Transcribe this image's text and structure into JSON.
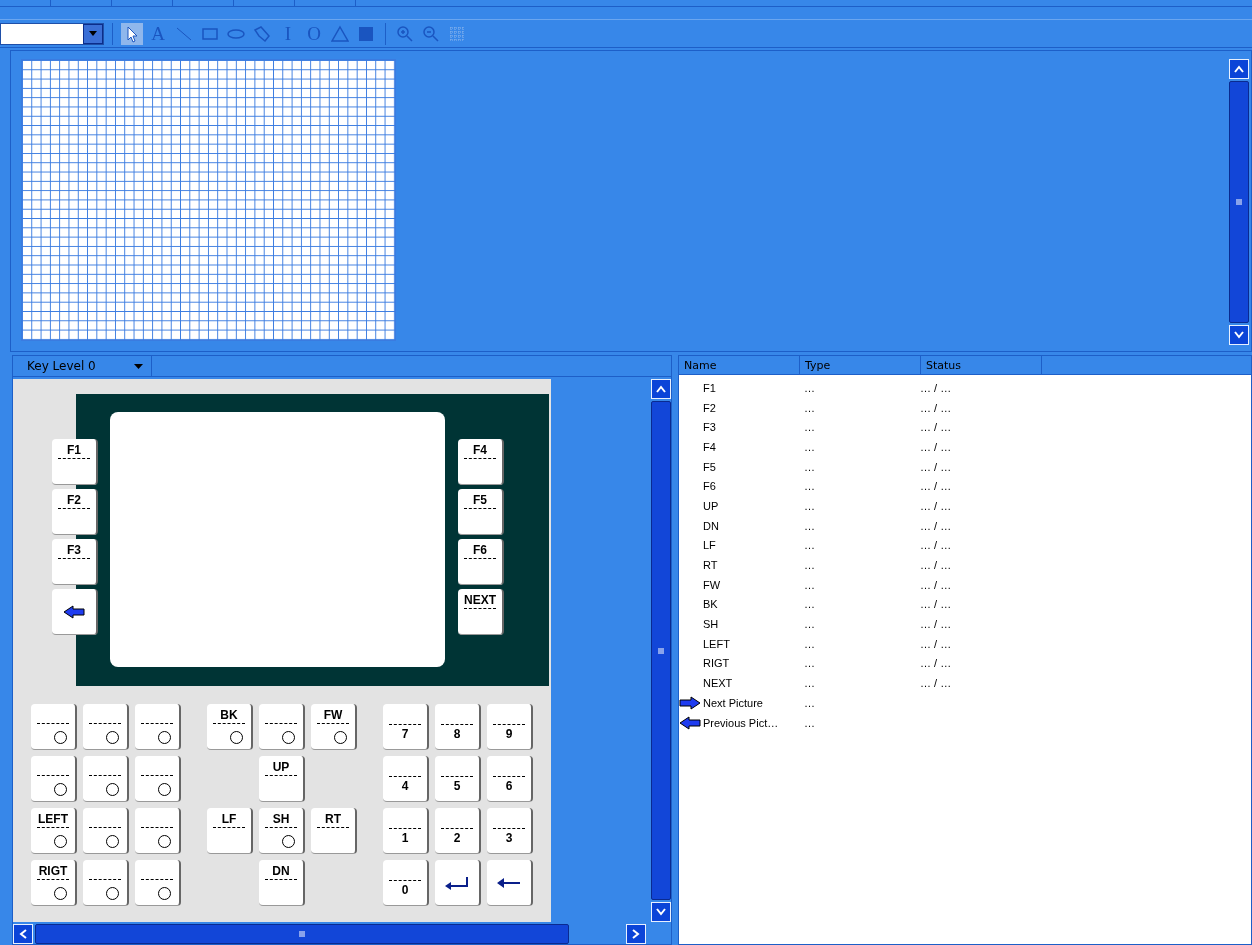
{
  "toolbar": {
    "tools": [
      {
        "kind": "pointer",
        "selected": true
      },
      {
        "kind": "glyph",
        "glyph": "A",
        "selected": false
      },
      {
        "kind": "line",
        "selected": false
      },
      {
        "kind": "rect",
        "selected": false
      },
      {
        "kind": "ellipse",
        "selected": false
      },
      {
        "kind": "polygon",
        "selected": false
      },
      {
        "kind": "glyph",
        "glyph": "I",
        "selected": false
      },
      {
        "kind": "glyph",
        "glyph": "O",
        "selected": false
      },
      {
        "kind": "warning",
        "selected": false
      },
      {
        "kind": "fill",
        "selected": false
      },
      {
        "kind": "zoom-in",
        "selected": false
      },
      {
        "kind": "zoom-out",
        "selected": false
      },
      {
        "kind": "grid",
        "selected": false
      }
    ]
  },
  "key_level": {
    "label": "Key Level 0"
  },
  "device": {
    "left_keys": [
      {
        "kind": "label",
        "label": "F1",
        "led": false
      },
      {
        "kind": "label",
        "label": "F2",
        "led": false
      },
      {
        "kind": "label",
        "label": "F3",
        "led": false
      },
      {
        "kind": "back-arrow"
      }
    ],
    "right_keys": [
      {
        "kind": "label",
        "label": "F4",
        "led": false
      },
      {
        "kind": "label",
        "label": "F5",
        "led": false
      },
      {
        "kind": "label",
        "label": "F6",
        "led": false
      },
      {
        "kind": "label",
        "label": "NEXT",
        "led": false
      }
    ]
  },
  "keypad": {
    "blocks": [
      [
        [
          {
            "kind": "label",
            "led": true
          },
          {
            "kind": "label",
            "led": true
          },
          {
            "kind": "label",
            "led": true
          }
        ],
        [
          {
            "kind": "label",
            "led": true
          },
          {
            "kind": "label",
            "led": true
          },
          {
            "kind": "label",
            "led": true
          }
        ],
        [
          {
            "kind": "label",
            "label": "LEFT",
            "led": true
          },
          {
            "kind": "label",
            "led": true
          },
          {
            "kind": "label",
            "led": true
          }
        ],
        [
          {
            "kind": "label",
            "label": "RIGT",
            "led": true
          },
          {
            "kind": "label",
            "led": true
          },
          {
            "kind": "label",
            "led": true
          }
        ]
      ],
      {
        "top": [
          {
            "kind": "label",
            "label": "BK",
            "led": true
          },
          {
            "kind": "label",
            "led": true
          },
          {
            "kind": "label",
            "label": "FW",
            "led": true
          }
        ],
        "up": {
          "kind": "label",
          "label": "UP",
          "led": false
        },
        "middle": [
          {
            "kind": "label",
            "label": "LF",
            "led": false
          },
          {
            "kind": "label",
            "label": "SH",
            "led": true
          },
          {
            "kind": "label",
            "label": "RT",
            "led": false
          }
        ],
        "down": {
          "kind": "label",
          "label": "DN",
          "led": false
        }
      },
      [
        [
          {
            "kind": "digit",
            "label": "7"
          },
          {
            "kind": "digit",
            "label": "8"
          },
          {
            "kind": "digit",
            "label": "9"
          }
        ],
        [
          {
            "kind": "digit",
            "label": "4"
          },
          {
            "kind": "digit",
            "label": "5"
          },
          {
            "kind": "digit",
            "label": "6"
          }
        ],
        [
          {
            "kind": "digit",
            "label": "1"
          },
          {
            "kind": "digit",
            "label": "2"
          },
          {
            "kind": "digit",
            "label": "3"
          }
        ],
        [
          {
            "kind": "digit",
            "label": "0"
          },
          {
            "kind": "enter"
          },
          {
            "kind": "backspace"
          }
        ]
      ]
    ]
  },
  "list": {
    "columns": [
      "Name",
      "Type",
      "Status"
    ],
    "rows": [
      {
        "kind": "key",
        "name": "F1",
        "type": "…",
        "status": "… / …"
      },
      {
        "kind": "key",
        "name": "F2",
        "type": "…",
        "status": "… / …"
      },
      {
        "kind": "key",
        "name": "F3",
        "type": "…",
        "status": "… / …"
      },
      {
        "kind": "key",
        "name": "F4",
        "type": "…",
        "status": "… / …"
      },
      {
        "kind": "key",
        "name": "F5",
        "type": "…",
        "status": "… / …"
      },
      {
        "kind": "key",
        "name": "F6",
        "type": "…",
        "status": "… / …"
      },
      {
        "kind": "key",
        "name": "UP",
        "type": "…",
        "status": "… / …"
      },
      {
        "kind": "key",
        "name": "DN",
        "type": "…",
        "status": "… / …"
      },
      {
        "kind": "key",
        "name": "LF",
        "type": "…",
        "status": "… / …"
      },
      {
        "kind": "key",
        "name": "RT",
        "type": "…",
        "status": "… / …"
      },
      {
        "kind": "key",
        "name": "FW",
        "type": "…",
        "status": "… / …"
      },
      {
        "kind": "key",
        "name": "BK",
        "type": "…",
        "status": "… / …"
      },
      {
        "kind": "key",
        "name": "SH",
        "type": "…",
        "status": "… / …"
      },
      {
        "kind": "key",
        "name": "LEFT",
        "type": "…",
        "status": "… / …"
      },
      {
        "kind": "key",
        "name": "RIGT",
        "type": "…",
        "status": "… / …"
      },
      {
        "kind": "key",
        "name": "NEXT",
        "type": "…",
        "status": "… / …"
      },
      {
        "kind": "next-picture",
        "name": "Next Picture",
        "type": "…"
      },
      {
        "kind": "previous-picture",
        "name": "Previous Pict…",
        "type": "…"
      }
    ]
  }
}
